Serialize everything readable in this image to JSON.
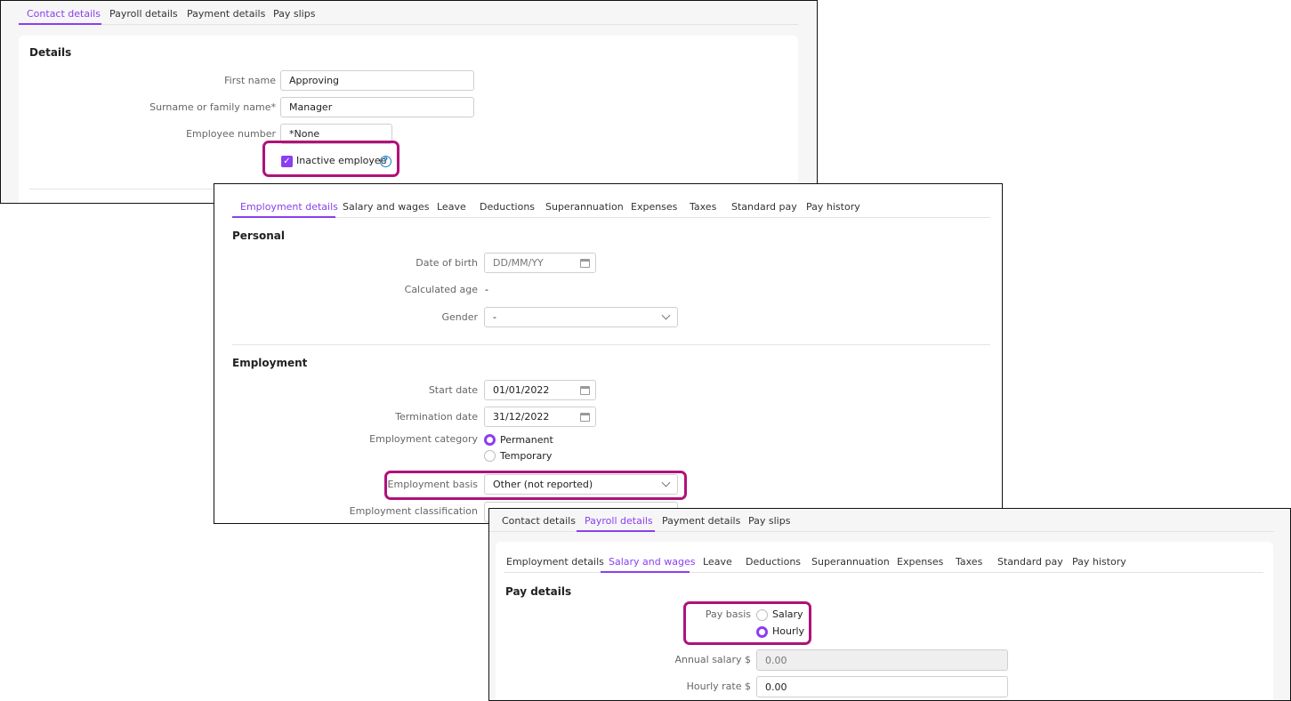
{
  "colors": {
    "accent": "#8a3ff0",
    "highlight": "#b0127a",
    "help": "#1a7fc4"
  },
  "panel1": {
    "tabs": [
      "Contact details",
      "Payroll details",
      "Payment details",
      "Pay slips"
    ],
    "active_tab": "Contact details",
    "section": "Details",
    "first_name_label": "First name",
    "first_name": "Approving",
    "surname_label": "Surname or family name*",
    "surname": "Manager",
    "employee_number_label": "Employee number",
    "employee_number": "*None",
    "inactive_label": "Inactive employee",
    "inactive_checked": true
  },
  "panel2": {
    "tabs": [
      "Employment details",
      "Salary and wages",
      "Leave",
      "Deductions",
      "Superannuation",
      "Expenses",
      "Taxes",
      "Standard pay",
      "Pay history"
    ],
    "active_tab": "Employment details",
    "personal": "Personal",
    "dob_label": "Date of birth",
    "dob_placeholder": "DD/MM/YY",
    "age_label": "Calculated age",
    "age": "-",
    "gender_label": "Gender",
    "gender": "-",
    "employment": "Employment",
    "start_label": "Start date",
    "start": "01/01/2022",
    "term_label": "Termination date",
    "term": "31/12/2022",
    "category_label": "Employment category",
    "category_options": [
      "Permanent",
      "Temporary"
    ],
    "category_selected": "Permanent",
    "basis_label": "Employment basis",
    "basis": "Other (not reported)",
    "classification_label": "Employment classification"
  },
  "panel3": {
    "tabs": [
      "Contact details",
      "Payroll details",
      "Payment details",
      "Pay slips"
    ],
    "active_tab": "Payroll details",
    "subtabs": [
      "Employment details",
      "Salary and wages",
      "Leave",
      "Deductions",
      "Superannuation",
      "Expenses",
      "Taxes",
      "Standard pay",
      "Pay history"
    ],
    "active_subtab": "Salary and wages",
    "section": "Pay details",
    "pay_basis_label": "Pay basis",
    "pay_basis_options": [
      "Salary",
      "Hourly"
    ],
    "pay_basis_selected": "Hourly",
    "annual_label": "Annual salary $",
    "annual": "0.00",
    "hourly_label": "Hourly rate $",
    "hourly": "0.00"
  }
}
